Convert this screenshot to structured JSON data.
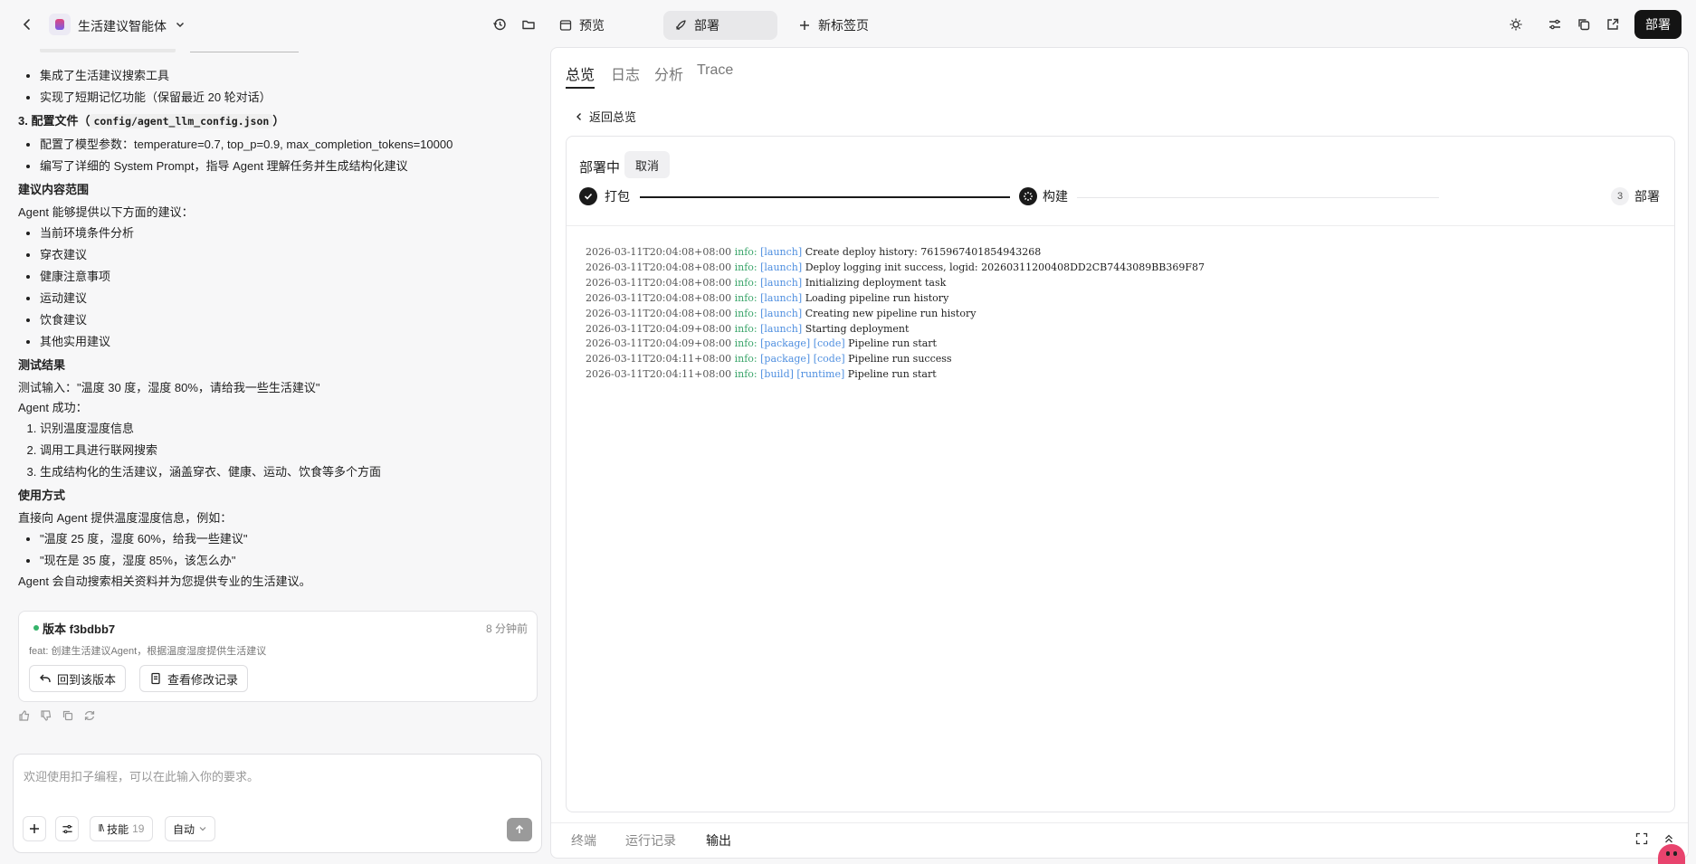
{
  "header": {
    "project_name": "生活建议智能体",
    "tabs": [
      {
        "label": "预览"
      },
      {
        "label": "部署"
      },
      {
        "label": "新标签页"
      }
    ],
    "deploy_button": "部署"
  },
  "chat": {
    "lines": {
      "b1": "集成了生活建议搜索工具",
      "b2": "实现了短期记忆功能（保留最近 20 轮对话）",
      "h3_prefix": "3. 配置文件（",
      "h3_code": "config/agent_llm_config.json",
      "h3_suffix": "）",
      "b3": "配置了模型参数：temperature=0.7, top_p=0.9, max_completion_tokens=10000",
      "b4": "编写了详细的 System Prompt，指导 Agent 理解任务并生成结构化建议",
      "h_scope": "建议内容范围",
      "p_scope": "Agent 能够提供以下方面的建议：",
      "scope_items": [
        "当前环境条件分析",
        "穿衣建议",
        "健康注意事项",
        "运动建议",
        "饮食建议",
        "其他实用建议"
      ],
      "h_test": "测试结果",
      "p_test1": "测试输入：\"温度 30 度，湿度 80%，请给我一些生活建议\"",
      "p_test2": "Agent 成功：",
      "test_items": [
        "识别温度湿度信息",
        "调用工具进行联网搜索",
        "生成结构化的生活建议，涵盖穿衣、健康、运动、饮食等多个方面"
      ],
      "h_usage": "使用方式",
      "p_usage": "直接向 Agent 提供温度湿度信息，例如：",
      "usage_items": [
        "\"温度 25 度，湿度 60%，给我一些建议\"",
        "\"现在是 35 度，湿度 85%，该怎么办\""
      ],
      "p_end": "Agent 会自动搜索相关资料并为您提供专业的生活建议。"
    },
    "version": {
      "label": "版本 f3bdbb7",
      "time": "8 分钟前",
      "commit": "feat: 创建生活建议Agent，根据温度湿度提供生活建议",
      "revert_button": "回到该版本",
      "history_button": "查看修改记录"
    },
    "input": {
      "placeholder": "欢迎使用扣子编程，可以在此输入你的要求。",
      "skills_label": "技能",
      "skills_count": "19",
      "mode": "自动"
    }
  },
  "deploy": {
    "tabs": [
      "总览",
      "日志",
      "分析",
      "Trace"
    ],
    "back": "返回总览",
    "status": "部署中",
    "cancel": "取消",
    "steps": [
      {
        "label": "打包",
        "state": "done"
      },
      {
        "label": "构建",
        "state": "running"
      },
      {
        "label": "部署",
        "number": "3",
        "state": "pending"
      }
    ],
    "logs": [
      {
        "ts": "2026-03-11T20:04:08+08:00",
        "level": "info:",
        "tags": "[launch]",
        "msg": "Create deploy history: 7615967401854943268"
      },
      {
        "ts": "2026-03-11T20:04:08+08:00",
        "level": "info:",
        "tags": "[launch]",
        "msg": "Deploy logging init success, logid: 20260311200408DD2CB7443089BB369F87"
      },
      {
        "ts": "2026-03-11T20:04:08+08:00",
        "level": "info:",
        "tags": "[launch]",
        "msg": "Initializing deployment task"
      },
      {
        "ts": "2026-03-11T20:04:08+08:00",
        "level": "info:",
        "tags": "[launch]",
        "msg": "Loading pipeline run history"
      },
      {
        "ts": "2026-03-11T20:04:08+08:00",
        "level": "info:",
        "tags": "[launch]",
        "msg": "Creating new pipeline run history"
      },
      {
        "ts": "2026-03-11T20:04:09+08:00",
        "level": "info:",
        "tags": "[launch]",
        "msg": "Starting deployment"
      },
      {
        "ts": "2026-03-11T20:04:09+08:00",
        "level": "info:",
        "tags": "[package] [code]",
        "msg": "Pipeline run start"
      },
      {
        "ts": "2026-03-11T20:04:11+08:00",
        "level": "info:",
        "tags": "[package] [code]",
        "msg": "Pipeline run success"
      },
      {
        "ts": "2026-03-11T20:04:11+08:00",
        "level": "info:",
        "tags": "[build] [runtime]",
        "msg": "Pipeline run start"
      }
    ],
    "bottom_tabs": [
      "终端",
      "运行记录",
      "输出"
    ]
  }
}
